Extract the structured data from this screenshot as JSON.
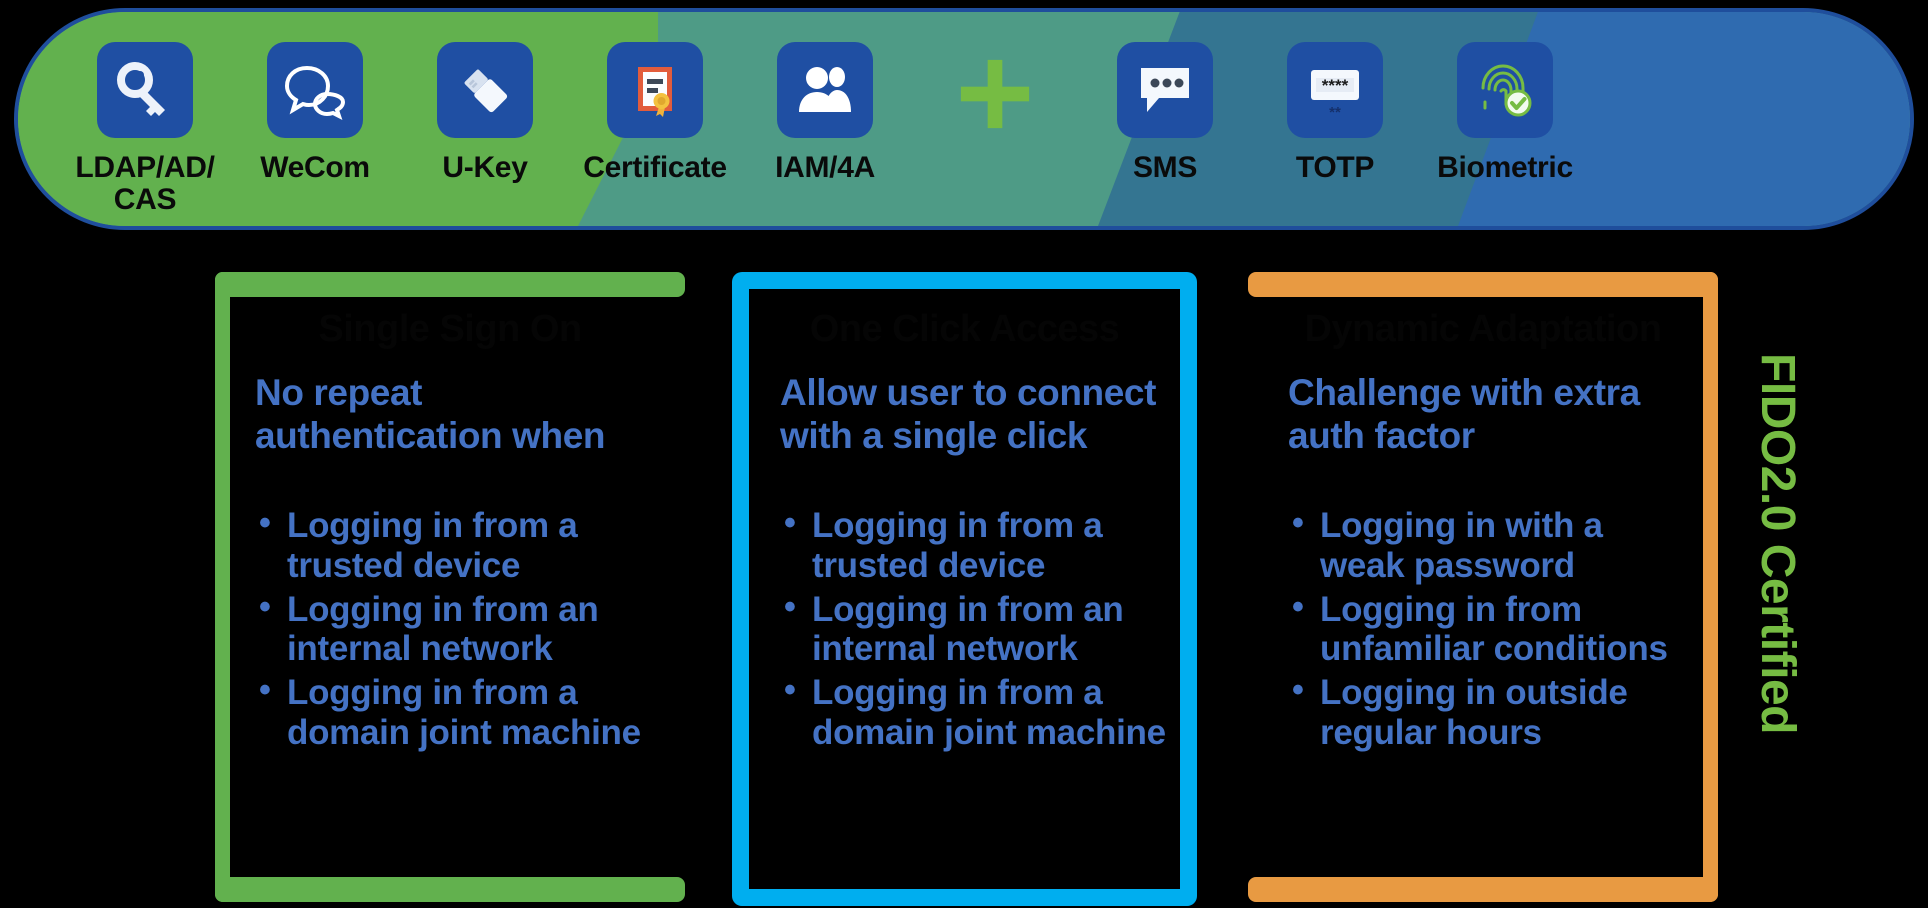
{
  "banner": {
    "methods": [
      {
        "label": "LDAP/AD/\nCAS",
        "icon": "key-icon",
        "name": "auth-method-ldap-ad-cas"
      },
      {
        "label": "WeCom",
        "icon": "chat-bubble-icon",
        "name": "auth-method-wecom"
      },
      {
        "label": "U-Key",
        "icon": "usb-key-icon",
        "name": "auth-method-ukey"
      },
      {
        "label": "Certificate",
        "icon": "certificate-icon",
        "name": "auth-method-certificate"
      },
      {
        "label": "IAM/4A",
        "icon": "users-icon",
        "name": "auth-method-iam-4a"
      },
      {
        "label": "SMS",
        "icon": "sms-icon",
        "name": "auth-method-sms"
      },
      {
        "label": "TOTP",
        "icon": "otp-keypad-icon",
        "name": "auth-method-totp"
      },
      {
        "label": "Biometric",
        "icon": "fingerprint-check-icon",
        "name": "auth-method-biometric"
      }
    ],
    "plus_icon": "plus-icon",
    "colors": {
      "band_green": "#62B14E",
      "band_teal_green": "#4E9B86",
      "band_teal_blue": "#347591",
      "band_blue": "#2F6BB0",
      "outline": "#1F4E9C",
      "tile": "#1F4FA3",
      "plus": "#76BC43"
    }
  },
  "cards": [
    {
      "title": "Single Sign On",
      "lead": "No repeat authentication when",
      "bullets": [
        "Logging in from a trusted device",
        "Logging in from an internal network",
        "Logging in from a domain joint machine"
      ],
      "accent": "#62B14E"
    },
    {
      "title": "One Click Access",
      "lead": "Allow user to connect with a single click",
      "bullets": [
        "Logging in from a trusted device",
        "Logging in from an internal network",
        "Logging in from a domain joint machine"
      ],
      "accent": "#00AEEF"
    },
    {
      "title": "Dynamic Adaptation",
      "lead": "Challenge with extra auth factor",
      "bullets": [
        "Logging in with a weak password",
        "Logging in from unfamiliar conditions",
        "Logging in outside regular hours"
      ],
      "accent": "#E89A42"
    }
  ],
  "badge": {
    "text": "FIDO2.0 Certified",
    "color": "#76BC43"
  },
  "body_text_color": "#4472C4"
}
